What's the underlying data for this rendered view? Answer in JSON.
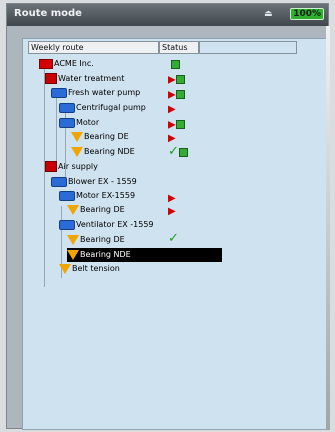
{
  "window": {
    "title": "Route mode",
    "battery": "100%"
  },
  "table": {
    "headers": [
      "Weekly route",
      "Status"
    ]
  },
  "tree": [
    {
      "label": "ACME Inc.",
      "icon": "company-icon",
      "status": "green"
    },
    {
      "label": "Water treatment",
      "icon": "building-icon",
      "status": "red-green"
    },
    {
      "label": "Fresh water pump",
      "icon": "pump-icon",
      "status": "red-green"
    },
    {
      "label": "Centrifugal pump",
      "icon": "pump-icon",
      "status": "red"
    },
    {
      "label": "Motor",
      "icon": "pump-icon",
      "status": "red-green"
    },
    {
      "label": "Bearing DE",
      "icon": "bearing-icon",
      "status": "red"
    },
    {
      "label": "Bearing NDE",
      "icon": "bearing-icon",
      "status": "check-green"
    },
    {
      "label": "Air supply",
      "icon": "building-icon",
      "status": ""
    },
    {
      "label": "Blower EX - 1559",
      "icon": "pump-icon",
      "status": ""
    },
    {
      "label": "Motor EX-1559",
      "icon": "pump-icon",
      "status": "red"
    },
    {
      "label": "Bearing DE",
      "icon": "bearing-icon",
      "status": "red"
    },
    {
      "label": "Ventilator EX -1559",
      "icon": "pump-icon",
      "status": ""
    },
    {
      "label": "Bearing DE",
      "icon": "bearing-icon",
      "status": "check"
    },
    {
      "label": "Bearing NDE",
      "icon": "bearing-icon",
      "status": "selected"
    },
    {
      "label": "Belt tension",
      "icon": "bearing-icon",
      "status": ""
    }
  ]
}
